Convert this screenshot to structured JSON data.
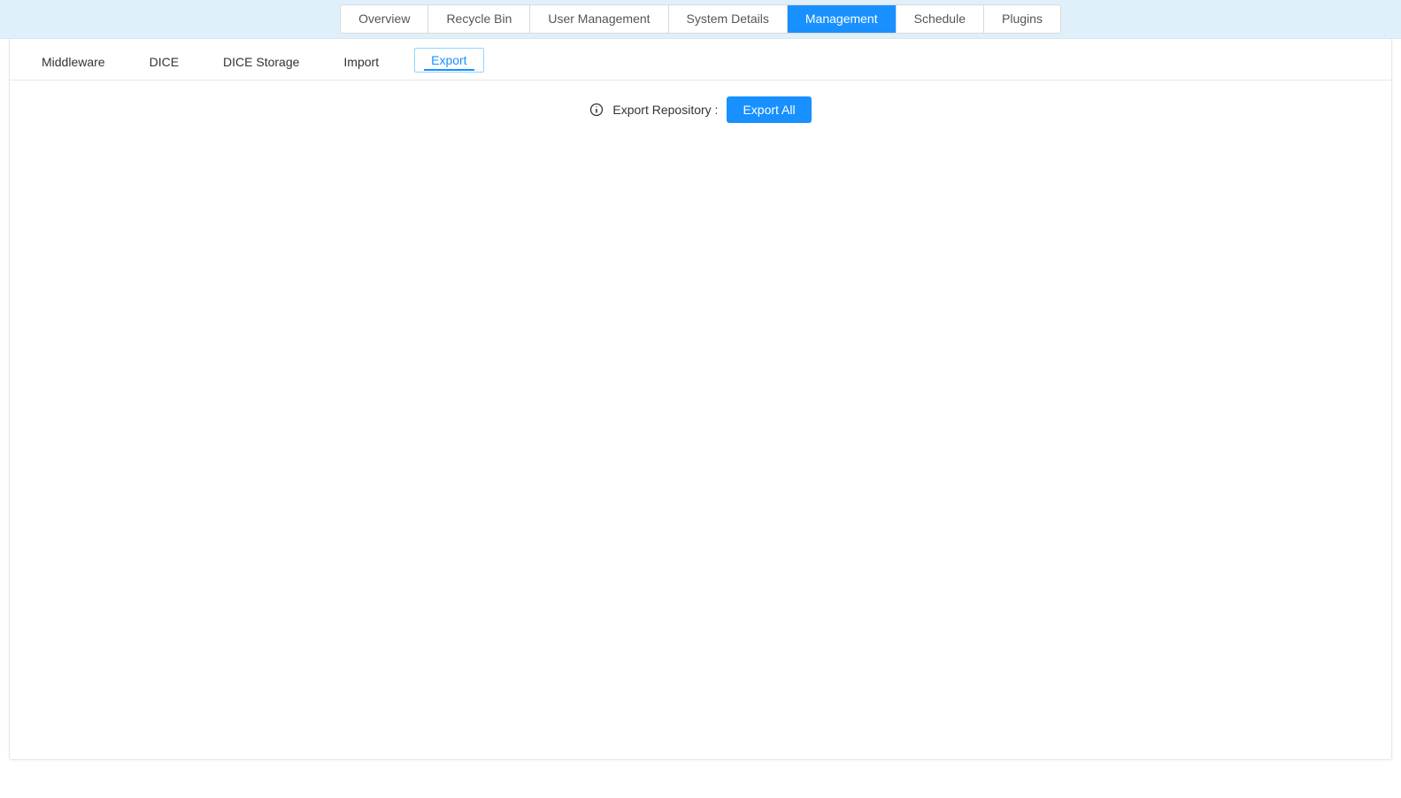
{
  "top_tabs": [
    {
      "label": "Overview"
    },
    {
      "label": "Recycle Bin"
    },
    {
      "label": "User Management"
    },
    {
      "label": "System Details"
    },
    {
      "label": "Management",
      "active": true
    },
    {
      "label": "Schedule"
    },
    {
      "label": "Plugins"
    }
  ],
  "sub_tabs": [
    {
      "label": "Middleware"
    },
    {
      "label": "DICE"
    },
    {
      "label": "DICE Storage"
    },
    {
      "label": "Import"
    },
    {
      "label": "Export",
      "active": true
    }
  ],
  "export": {
    "label": "Export Repository :",
    "button_label": "Export All"
  }
}
